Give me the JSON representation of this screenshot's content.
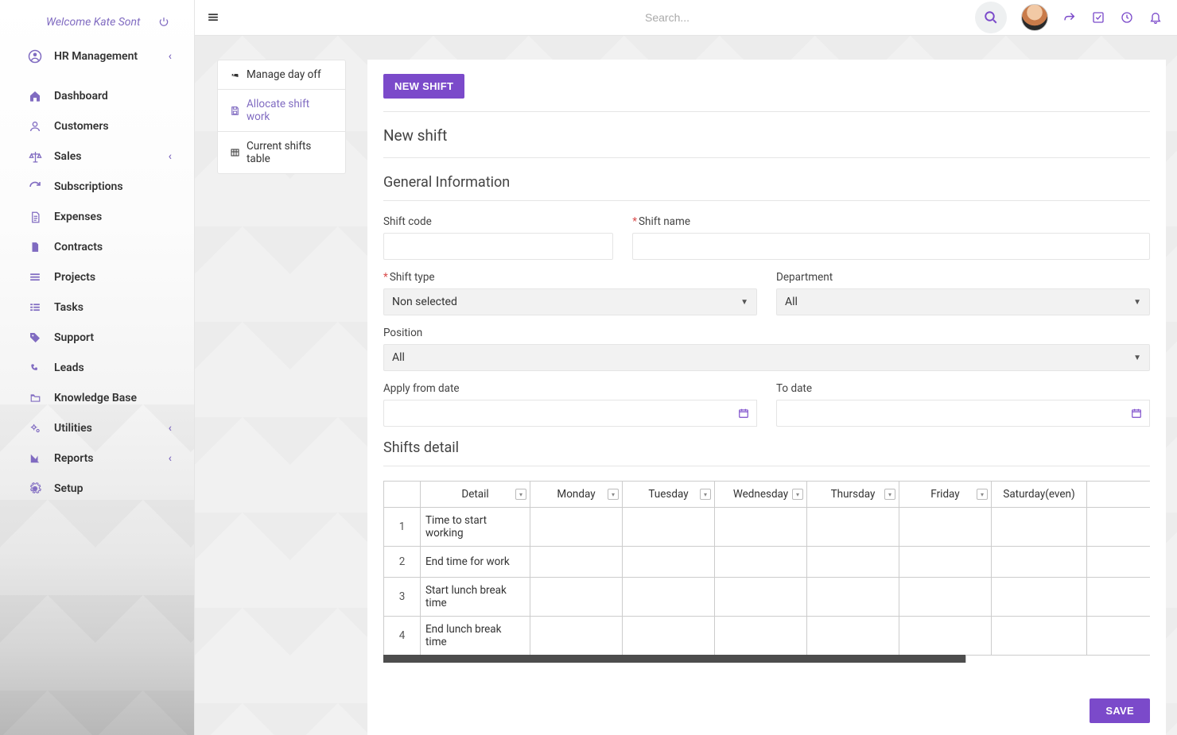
{
  "welcome_text": "Welcome Kate Sont",
  "sidebar": {
    "heading": "HR Management",
    "items": [
      {
        "label": "Dashboard",
        "collapsible": false
      },
      {
        "label": "Customers",
        "collapsible": false
      },
      {
        "label": "Sales",
        "collapsible": true
      },
      {
        "label": "Subscriptions",
        "collapsible": false
      },
      {
        "label": "Expenses",
        "collapsible": false
      },
      {
        "label": "Contracts",
        "collapsible": false
      },
      {
        "label": "Projects",
        "collapsible": false
      },
      {
        "label": "Tasks",
        "collapsible": false
      },
      {
        "label": "Support",
        "collapsible": false
      },
      {
        "label": "Leads",
        "collapsible": false
      },
      {
        "label": "Knowledge Base",
        "collapsible": false
      },
      {
        "label": "Utilities",
        "collapsible": true
      },
      {
        "label": "Reports",
        "collapsible": true
      },
      {
        "label": "Setup",
        "collapsible": false
      }
    ]
  },
  "topbar": {
    "search_placeholder": "Search..."
  },
  "submenu": {
    "items": [
      {
        "label": "Manage day off",
        "active": false
      },
      {
        "label": "Allocate shift work",
        "active": true
      },
      {
        "label": "Current shifts table",
        "active": false
      }
    ]
  },
  "panel": {
    "new_shift_btn": "NEW SHIFT",
    "title": "New shift",
    "section_general": "General Information",
    "section_detail": "Shifts detail",
    "save_btn": "SAVE",
    "fields": {
      "shift_code_label": "Shift code",
      "shift_name_label": "Shift name",
      "shift_type_label": "Shift type",
      "shift_type_value": "Non selected",
      "department_label": "Department",
      "department_value": "All",
      "position_label": "Position",
      "position_value": "All",
      "apply_from_label": "Apply from date",
      "to_date_label": "To date"
    }
  },
  "table": {
    "headers": [
      "",
      "Detail",
      "Monday",
      "Tuesday",
      "Wednesday",
      "Thursday",
      "Friday",
      "Saturday(even)"
    ],
    "rows": [
      {
        "n": "1",
        "detail": "Time to start working"
      },
      {
        "n": "2",
        "detail": "End time for work"
      },
      {
        "n": "3",
        "detail": "Start lunch break time"
      },
      {
        "n": "4",
        "detail": "End lunch break time"
      }
    ]
  }
}
